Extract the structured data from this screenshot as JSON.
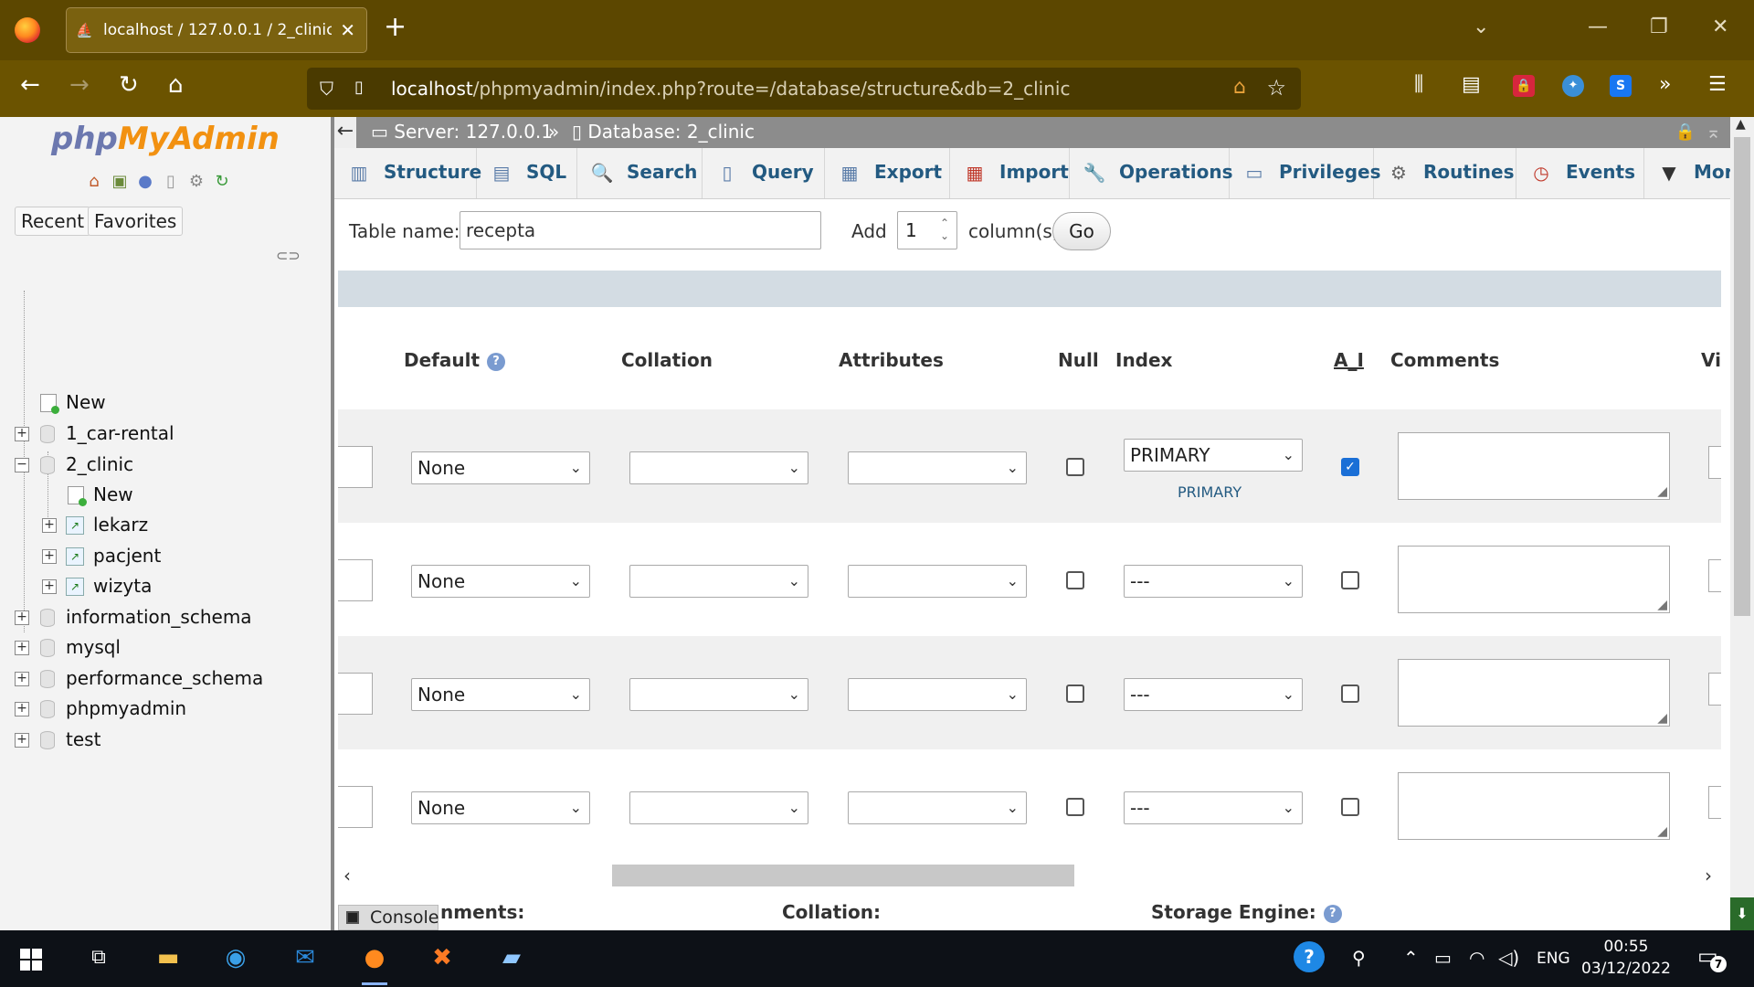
{
  "browser": {
    "tab_title": "localhost / 127.0.0.1 / 2_clinic / ...",
    "url_host": "localhost",
    "url_path": "/phpmyadmin/index.php?route=/database/structure&db=2_clinic",
    "new_tab": "+",
    "tab_close": "✕"
  },
  "left": {
    "logo_php": "php",
    "logo_my": "MyAdmin",
    "tab_recent": "Recent",
    "tab_favorites": "Favorites",
    "tree": [
      {
        "label": "New"
      },
      {
        "label": "1_car-rental"
      },
      {
        "label": "2_clinic"
      },
      {
        "label": "New"
      },
      {
        "label": "lekarz"
      },
      {
        "label": "pacjent"
      },
      {
        "label": "wizyta"
      },
      {
        "label": "information_schema"
      },
      {
        "label": "mysql"
      },
      {
        "label": "performance_schema"
      },
      {
        "label": "phpmyadmin"
      },
      {
        "label": "test"
      }
    ]
  },
  "breadcrumb": {
    "server": "Server: 127.0.0.1",
    "separator": "»",
    "database": "Database: 2_clinic"
  },
  "menu": [
    {
      "label": "Structure",
      "icon": "structure-icon"
    },
    {
      "label": "SQL",
      "icon": "sql-icon"
    },
    {
      "label": "Search",
      "icon": "search-icon"
    },
    {
      "label": "Query",
      "icon": "query-icon"
    },
    {
      "label": "Export",
      "icon": "export-icon"
    },
    {
      "label": "Import",
      "icon": "import-icon"
    },
    {
      "label": "Operations",
      "icon": "operations-icon"
    },
    {
      "label": "Privileges",
      "icon": "privileges-icon"
    },
    {
      "label": "Routines",
      "icon": "routines-icon"
    },
    {
      "label": "Events",
      "icon": "events-icon"
    },
    {
      "label": "More",
      "icon": "chevron-down-icon"
    }
  ],
  "form": {
    "table_name_label": "Table name:",
    "table_name_value": "recepta",
    "add_label": "Add",
    "add_value": "1",
    "columns_label": "column(s)",
    "go_label": "Go"
  },
  "columns": {
    "default": "Default",
    "collation": "Collation",
    "attributes": "Attributes",
    "null": "Null",
    "index": "Index",
    "ai": "A_I",
    "comments": "Comments",
    "virtuality": "Vi"
  },
  "rows": [
    {
      "default": "None",
      "collation": "",
      "attributes": "",
      "null": false,
      "index": "PRIMARY",
      "index_note": "PRIMARY",
      "ai": true
    },
    {
      "default": "None",
      "collation": "",
      "attributes": "",
      "null": false,
      "index": "---",
      "ai": false
    },
    {
      "default": "None",
      "collation": "",
      "attributes": "",
      "null": false,
      "index": "---",
      "ai": false
    },
    {
      "default": "None",
      "collation": "",
      "attributes": "",
      "null": false,
      "index": "---",
      "ai": false
    }
  ],
  "bottom": {
    "comments_partial": "nments:",
    "collation": "Collation:",
    "storage_engine": "Storage Engine:",
    "console": "Console"
  },
  "taskbar": {
    "time": "00:55",
    "date": "03/12/2022",
    "lang": "ENG",
    "notifications": "7"
  },
  "colors": {
    "chrome_title": "#5c4700",
    "chrome_nav": "#6b5300",
    "pma_link": "#235a81",
    "header_band": "#d3dce3",
    "checkbox_on": "#1a6fd6"
  }
}
